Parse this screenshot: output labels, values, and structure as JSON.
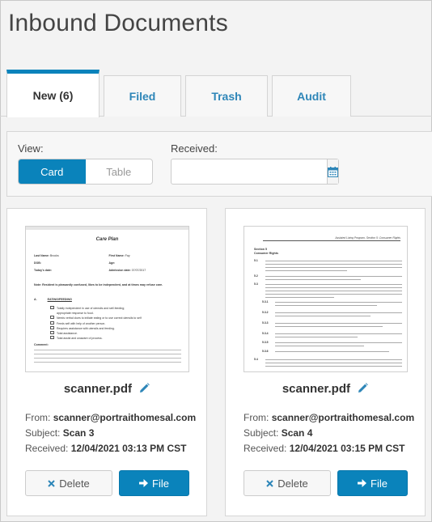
{
  "page_title": "Inbound Documents",
  "tabs": [
    {
      "label": "New (6)",
      "active": true
    },
    {
      "label": "Filed",
      "active": false
    },
    {
      "label": "Trash",
      "active": false
    },
    {
      "label": "Audit",
      "active": false
    }
  ],
  "filters": {
    "view_label": "View:",
    "view_options": [
      "Card",
      "Table"
    ],
    "view_selected": "Card",
    "received_label": "Received:",
    "received_value": "",
    "calendar_icon": "calendar-icon"
  },
  "colors": {
    "accent": "#0a83bb",
    "tab_text": "#2e86b8"
  },
  "cards": [
    {
      "filename": "scanner.pdf",
      "from_label": "From:",
      "from": "scanner@portraithomesal.com",
      "subject_label": "Subject:",
      "subject": "Scan 3",
      "received_label": "Received:",
      "received": "12/04/2021 03:13 PM CST",
      "delete_label": "Delete",
      "file_label": "File",
      "thumb": {
        "title": "Care Plan",
        "last_name_label": "Last Name:",
        "last_name": "Brooks",
        "first_name_label": "First Name:",
        "first_name": "Fay",
        "dob_label": "DOB:",
        "age_label": "Age:",
        "today_label": "Today's date:",
        "admission_label": "Admission date:",
        "admission": "07/07/2017",
        "note": "Note: Resident is pleasantly confused, likes to be independent, and at times may refuse care.",
        "section": "A.",
        "section_title": "EATING/FEEDING",
        "items": [
          "Totally independent in use of utensils and self-feeding;",
          "appropriate response to food.",
          "Needs verbal clues to initiate eating or to use correct utensils to self",
          "Feeds self with help of another person.",
          "Requires assistance with utensils and feeding.",
          "Total assistance.",
          "Total assist and unaware of process."
        ],
        "comment_label": "Comment:"
      }
    },
    {
      "filename": "scanner.pdf",
      "from_label": "From:",
      "from": "scanner@portraithomesal.com",
      "subject_label": "Subject:",
      "subject": "Scan 4",
      "received_label": "Received:",
      "received": "12/04/2021 03:15 PM CST",
      "delete_label": "Delete",
      "file_label": "File",
      "thumb": {
        "header": "Assisted Living Program, Section 5: Consumer Rights",
        "section": "Section 5",
        "section_title": "Consumer Rights",
        "paras": [
          "5.1",
          "5.2",
          "5.3",
          "5.3.1",
          "5.3.2",
          "5.3.3",
          "5.3.4",
          "5.3.5",
          "5.3.6",
          "5.4"
        ]
      }
    }
  ]
}
